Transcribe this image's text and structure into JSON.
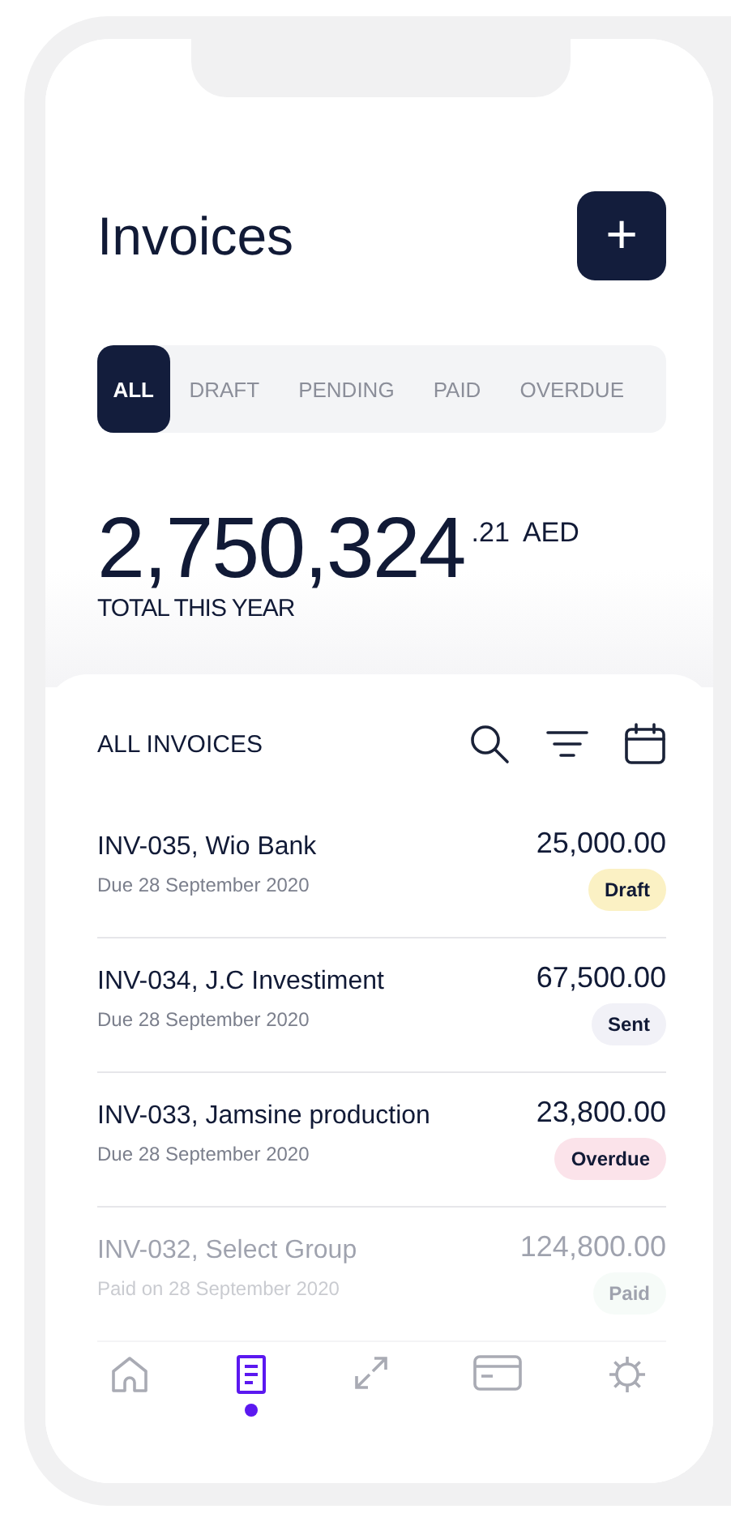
{
  "header": {
    "title": "Invoices",
    "add_button": "+"
  },
  "tabs": [
    {
      "label": "ALL",
      "selected": true
    },
    {
      "label": "DRAFT",
      "selected": false
    },
    {
      "label": "PENDING",
      "selected": false
    },
    {
      "label": "PAID",
      "selected": false
    },
    {
      "label": "OVERDUE",
      "selected": false
    }
  ],
  "total": {
    "amount": "2,750,324",
    "decimals": ".21",
    "currency": "AED",
    "label": "TOTAL THIS YEAR"
  },
  "list": {
    "title": "ALL INVOICES",
    "invoices": [
      {
        "name": "INV-035, Wio Bank",
        "date": "Due 28 September 2020",
        "amount": "25,000.00",
        "status": "Draft",
        "color": "#fbf1c4",
        "faded": false
      },
      {
        "name": "INV-034, J.C Investiment",
        "date": "Due 28 September 2020",
        "amount": "67,500.00",
        "status": "Sent",
        "color": "#f1f1f7",
        "faded": false
      },
      {
        "name": "INV-033, Jamsine production",
        "date": "Due 28 September 2020",
        "amount": "23,800.00",
        "status": "Overdue",
        "color": "#fbe3ea",
        "faded": false
      },
      {
        "name": "INV-032, Select Group",
        "date": "Paid on 28 September 2020",
        "amount": "124,800.00",
        "status": "Paid",
        "color": "#eaf6ef",
        "faded": true
      }
    ]
  },
  "nav": [
    {
      "kind": "home",
      "selected": false
    },
    {
      "kind": "invoices",
      "selected": true
    },
    {
      "kind": "transfer",
      "selected": false
    },
    {
      "kind": "card",
      "selected": false
    },
    {
      "kind": "settings",
      "selected": false
    }
  ]
}
